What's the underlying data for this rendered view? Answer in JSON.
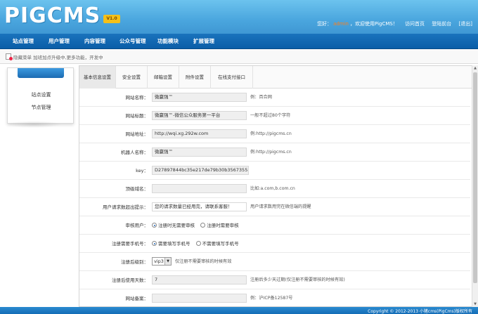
{
  "header": {
    "logo": "PIGCMS",
    "version": "V1.0",
    "greeting_prefix": "您好：",
    "username": "admin",
    "greeting_suffix": "，欢迎使用PigCMS！",
    "links": [
      "访问首页",
      "登陆前台",
      "[退出]"
    ]
  },
  "nav": [
    "站点管理",
    "用户管理",
    "内容管理",
    "公众号管理",
    "功能模块",
    "扩展管理"
  ],
  "notice": "隐藏菜单 加班加点升级中,更多功能，开发中",
  "sidebar": {
    "items": [
      "站点设置",
      "节点管理"
    ]
  },
  "tabs": [
    "基本信息设置",
    "安全设置",
    "邮箱设置",
    "附件设置",
    "在线支付接口"
  ],
  "form": {
    "site_name": {
      "label": "网站名称：",
      "value": "微赢强™",
      "hint": "例：百合网"
    },
    "site_title": {
      "label": "网站标题：",
      "value": "微赢强™-微信公众服务第一平台",
      "hint": "一般不超过80个字符"
    },
    "site_url": {
      "label": "网站地址：",
      "value": "http://wqi.xg.292w.com",
      "hint": "例:http://pigcms.cn"
    },
    "robot_name": {
      "label": "机器人名称：",
      "value": "微赢强™",
      "hint": "例:http://pigcms.cn"
    },
    "key": {
      "label": "key：",
      "value": "D27897844bc35e217de79b30b3567355"
    },
    "bind_domain": {
      "label": "顶级域名：",
      "value": "",
      "hint": "比如:a.com,b.com.cn"
    },
    "request_limit": {
      "label": "用户请求数超出提示：",
      "value": "您的请求数量已经用完，请联系客服！",
      "hint": "用户请求数用完在微信端的提醒"
    },
    "audit_user": {
      "label": "审核用户：",
      "options": [
        "注册时无需要审核",
        "注册时需要审核"
      ],
      "selected": 0
    },
    "need_phone": {
      "label": "注册需要手机号：",
      "options": [
        "需要填写手机号",
        "不需要填写手机号"
      ],
      "selected": 0
    },
    "reg_level": {
      "label": "注册后级别：",
      "value": "vip3",
      "hint": "仅注册不需要审核的时候有效"
    },
    "reg_days": {
      "label": "注册后使用天数：",
      "value": "7",
      "hint": "注册后多少天过期(仅注册不需要审核的时候有效)"
    },
    "icp": {
      "label": "网站备案：",
      "value": "",
      "hint": "例：沪ICP备12587号"
    }
  },
  "footer": "Copyright © 2012-2013 小猪cms(PigCms)版权所有"
}
